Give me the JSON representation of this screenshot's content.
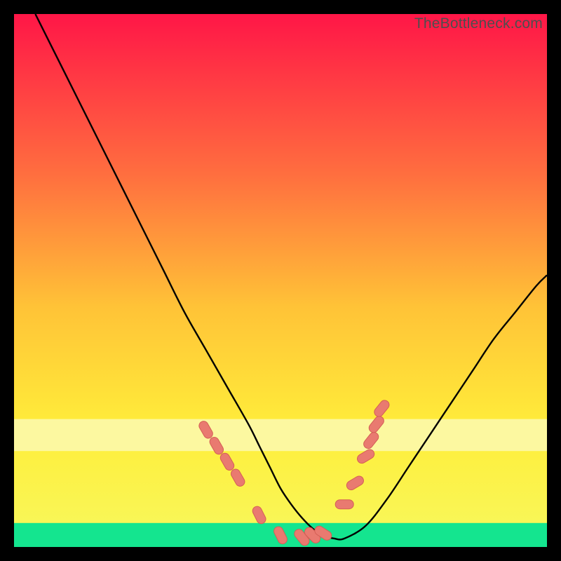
{
  "watermark": "TheBottleneck.com",
  "colors": {
    "black": "#000000",
    "curve": "#000000",
    "marker_fill": "#e97a70",
    "marker_stroke": "#d45f55",
    "grad_top": "#ff1647",
    "grad_mid1": "#ff6e3f",
    "grad_mid2": "#ffc337",
    "grad_mid3": "#ffee3a",
    "grad_band_pale": "#fcf8a0",
    "grad_band_green": "#2af598",
    "grad_bottom": "#07e38a"
  },
  "chart_data": {
    "type": "line",
    "title": "",
    "xlabel": "",
    "ylabel": "",
    "xlim": [
      0,
      100
    ],
    "ylim": [
      0,
      100
    ],
    "series": [
      {
        "name": "bottleneck-curve",
        "x": [
          4,
          8,
          12,
          16,
          20,
          24,
          28,
          32,
          36,
          40,
          44,
          46,
          48,
          50,
          52,
          54,
          56,
          58,
          60,
          62,
          66,
          70,
          74,
          78,
          82,
          86,
          90,
          94,
          98,
          100
        ],
        "y": [
          100,
          92,
          84,
          76,
          68,
          60,
          52,
          44,
          37,
          30,
          23,
          19,
          15,
          11,
          8,
          5.5,
          3.5,
          2.2,
          1.6,
          1.6,
          4,
          9,
          15,
          21,
          27,
          33,
          39,
          44,
          49,
          51
        ]
      }
    ],
    "markers": {
      "name": "highlight-points",
      "x": [
        36,
        38,
        40,
        42,
        46,
        50,
        54,
        56,
        58,
        62,
        64,
        66,
        67,
        68,
        69
      ],
      "y": [
        22,
        19,
        16,
        13,
        6,
        2.2,
        1.8,
        2.2,
        2.6,
        8,
        12,
        17,
        20,
        23,
        26
      ]
    },
    "bands": [
      {
        "name": "pale-yellow-band",
        "y0": 18,
        "y1": 24,
        "color": "#fcf8a0"
      },
      {
        "name": "green-band",
        "y0": 0,
        "y1": 4.5,
        "color": "#14e58f"
      }
    ]
  }
}
